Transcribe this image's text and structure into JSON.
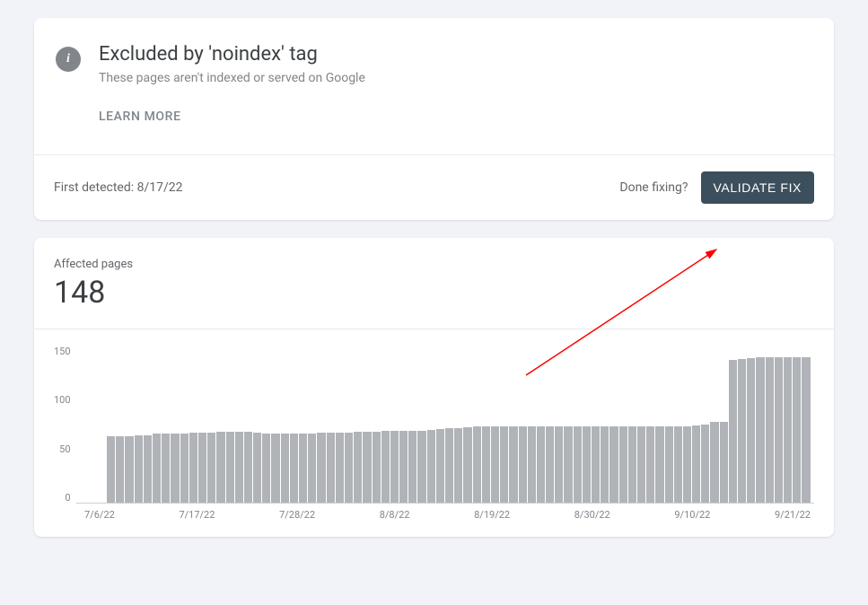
{
  "header": {
    "title": "Excluded by 'noindex' tag",
    "subtitle": "These pages aren't indexed or served on Google",
    "learn_more": "LEARN MORE",
    "first_detected_label": "First detected: 8/17/22",
    "done_fixing": "Done fixing?",
    "validate_fix": "VALIDATE FIX"
  },
  "chart": {
    "label": "Affected pages",
    "value": "148"
  },
  "chart_data": {
    "type": "bar",
    "title": "Affected pages",
    "xlabel": "",
    "ylabel": "",
    "ylim": [
      0,
      160
    ],
    "y_ticks": [
      "150",
      "100",
      "50",
      "0"
    ],
    "x_ticks": [
      "7/6/22",
      "7/17/22",
      "7/28/22",
      "8/8/22",
      "8/19/22",
      "8/30/22",
      "9/10/22",
      "9/21/22"
    ],
    "categories": [
      "7/6/22",
      "7/7/22",
      "7/8/22",
      "7/9/22",
      "7/10/22",
      "7/11/22",
      "7/12/22",
      "7/13/22",
      "7/14/22",
      "7/15/22",
      "7/16/22",
      "7/17/22",
      "7/18/22",
      "7/19/22",
      "7/20/22",
      "7/21/22",
      "7/22/22",
      "7/23/22",
      "7/24/22",
      "7/25/22",
      "7/26/22",
      "7/27/22",
      "7/28/22",
      "7/29/22",
      "7/30/22",
      "7/31/22",
      "8/1/22",
      "8/2/22",
      "8/3/22",
      "8/4/22",
      "8/5/22",
      "8/6/22",
      "8/7/22",
      "8/8/22",
      "8/9/22",
      "8/10/22",
      "8/11/22",
      "8/12/22",
      "8/13/22",
      "8/14/22",
      "8/15/22",
      "8/16/22",
      "8/17/22",
      "8/18/22",
      "8/19/22",
      "8/20/22",
      "8/21/22",
      "8/22/22",
      "8/23/22",
      "8/24/22",
      "8/25/22",
      "8/26/22",
      "8/27/22",
      "8/28/22",
      "8/29/22",
      "8/30/22",
      "8/31/22",
      "9/1/22",
      "9/2/22",
      "9/3/22",
      "9/4/22",
      "9/5/22",
      "9/6/22",
      "9/7/22",
      "9/8/22",
      "9/9/22",
      "9/10/22",
      "9/11/22",
      "9/12/22",
      "9/13/22",
      "9/14/22",
      "9/15/22",
      "9/16/22",
      "9/17/22",
      "9/18/22",
      "9/19/22",
      "9/20/22",
      "9/21/22",
      "9/22/22",
      "9/23/22"
    ],
    "values": [
      0,
      0,
      0,
      68,
      68,
      68,
      69,
      69,
      70,
      70,
      70,
      70,
      71,
      71,
      71,
      72,
      72,
      72,
      72,
      71,
      70,
      70,
      70,
      70,
      70,
      70,
      71,
      71,
      71,
      71,
      72,
      72,
      72,
      73,
      73,
      73,
      73,
      73,
      74,
      75,
      76,
      76,
      77,
      78,
      78,
      78,
      78,
      78,
      78,
      78,
      78,
      78,
      78,
      78,
      78,
      78,
      78,
      78,
      78,
      78,
      78,
      78,
      78,
      78,
      78,
      78,
      78,
      79,
      80,
      82,
      82,
      145,
      146,
      147,
      148,
      148,
      148,
      148,
      148,
      148
    ]
  }
}
